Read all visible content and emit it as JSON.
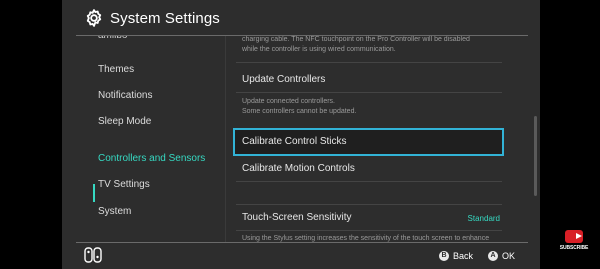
{
  "header": {
    "title": "System Settings"
  },
  "sidebar": {
    "cut_item": "amiibo",
    "items": [
      {
        "label": "Themes"
      },
      {
        "label": "Notifications"
      },
      {
        "label": "Sleep Mode"
      },
      {
        "label": "Controllers and Sensors"
      },
      {
        "label": "TV Settings"
      },
      {
        "label": "System"
      }
    ]
  },
  "content": {
    "top_desc_1": "charging cable. The NFC touchpoint on the Pro Controller will be disabled",
    "top_desc_2": "while the controller is using wired communication.",
    "update_label": "Update Controllers",
    "update_desc_1": "Update connected controllers.",
    "update_desc_2": "Some controllers cannot be updated.",
    "calibrate_sticks_label": "Calibrate Control Sticks",
    "calibrate_motion_label": "Calibrate Motion Controls",
    "touch_label": "Touch-Screen Sensitivity",
    "touch_value": "Standard",
    "touch_desc": "Using the Stylus setting increases the sensitivity of the touch screen to enhance"
  },
  "footer": {
    "b_glyph": "B",
    "back_label": "Back",
    "a_glyph": "A",
    "ok_label": "OK"
  },
  "overlay": {
    "subscribe_label": "SUBSCRIBE"
  },
  "colors": {
    "accent": "#36d9c2",
    "selection": "#32b3d6",
    "background": "#2d2d2d",
    "youtube": "#d81f26"
  },
  "icons": [
    "gear-icon",
    "joycon-icon",
    "youtube-play-icon"
  ]
}
